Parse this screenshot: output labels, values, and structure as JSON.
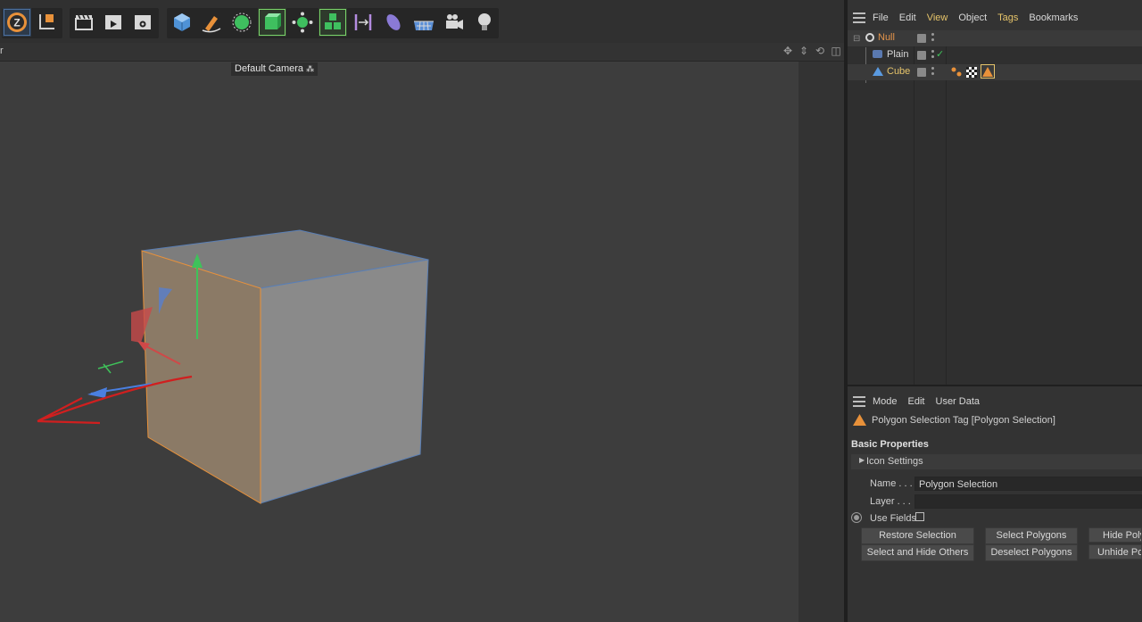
{
  "toolbar": {
    "icons": [
      "undo-z-icon",
      "coordinate-system-icon",
      "clapboard-icon",
      "render-view-icon",
      "render-settings-icon",
      "cube-icon",
      "pen-icon",
      "subdivision-icon",
      "extrude-icon",
      "cloner-icon",
      "array-icon",
      "deformer-icon",
      "field-icon",
      "floor-icon",
      "camera-icon",
      "light-icon"
    ]
  },
  "viewport": {
    "header_label": "r",
    "camera_label": "Default Camera"
  },
  "object_manager": {
    "menu": [
      "File",
      "Edit",
      "View",
      "Object",
      "Tags",
      "Bookmarks"
    ],
    "highlighted_menu": [
      "View",
      "Tags"
    ],
    "objects": [
      {
        "name": "Null",
        "color": "#e2934a",
        "indent": 0
      },
      {
        "name": "Plain",
        "color": "#d8d8d8",
        "indent": 1
      },
      {
        "name": "Cube",
        "color": "#e6c46a",
        "indent": 1
      }
    ]
  },
  "attribute_manager": {
    "menu": [
      "Mode",
      "Edit",
      "User Data"
    ],
    "tag_title": "Polygon Selection Tag [Polygon Selection]",
    "section": "Basic Properties",
    "subsection": "Icon Settings",
    "name_label": "Name . . .",
    "name_value": "Polygon Selection",
    "layer_label": "Layer . . .",
    "layer_value": "",
    "use_fields_label": "Use Fields",
    "buttons": {
      "restore_selection": "Restore Selection",
      "select_polygons": "Select Polygons",
      "hide_polygons": "Hide Polygons",
      "select_hide_others": "Select and Hide Others",
      "deselect_polygons": "Deselect Polygons",
      "unhide_polygons": "Unhide Polygons"
    }
  },
  "colors": {
    "accent_orange": "#e8913a",
    "accent_yellow": "#e6c46a",
    "active_green": "#7ad36a"
  }
}
